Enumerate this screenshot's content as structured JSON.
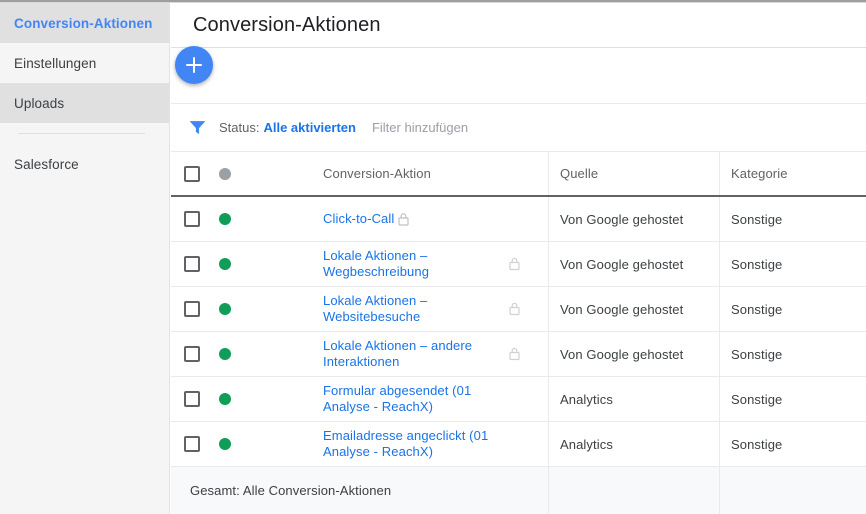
{
  "sidebar": {
    "items": [
      {
        "label": "Conversion-Aktionen",
        "state": "active"
      },
      {
        "label": "Einstellungen",
        "state": "normal"
      },
      {
        "label": "Uploads",
        "state": "shaded"
      }
    ],
    "secondary_items": [
      {
        "label": "Salesforce",
        "state": "normal"
      }
    ]
  },
  "header": {
    "title": "Conversion-Aktionen"
  },
  "toolbar": {
    "add_button_icon": "plus-icon",
    "add_button_label": "+"
  },
  "filter_bar": {
    "funnel_icon": "filter-funnel-icon",
    "status_label": "Status:",
    "status_value": "Alle aktivierten",
    "add_filter_label": "Filter hinzufügen"
  },
  "table": {
    "columns": {
      "select_all": "",
      "status": "",
      "name": "Conversion-Aktion",
      "source": "Quelle",
      "category": "Kategorie"
    },
    "header_status_dot": "gray",
    "rows": [
      {
        "name": "Click-to-Call",
        "status": "green",
        "lock": "inline",
        "source": "Von Google gehostet",
        "category": "Sonstige"
      },
      {
        "name": "Lokale Aktionen – Wegbeschreibung",
        "status": "green",
        "lock": "right",
        "source": "Von Google gehostet",
        "category": "Sonstige"
      },
      {
        "name": "Lokale Aktionen – Websitebesuche",
        "status": "green",
        "lock": "right",
        "source": "Von Google gehostet",
        "category": "Sonstige"
      },
      {
        "name": "Lokale Aktionen – andere Interaktionen",
        "status": "green",
        "lock": "right",
        "source": "Von Google gehostet",
        "category": "Sonstige"
      },
      {
        "name": "Formular abgesendet (01 Analyse - ReachX)",
        "status": "green",
        "lock": "none",
        "source": "Analytics",
        "category": "Sonstige"
      },
      {
        "name": "Emailadresse angeclickt (01 Analyse - ReachX)",
        "status": "green",
        "lock": "none",
        "source": "Analytics",
        "category": "Sonstige"
      }
    ],
    "total_row": {
      "label": "Gesamt: Alle Conversion-Aktionen",
      "source": "",
      "category": ""
    }
  },
  "colors": {
    "accent_blue": "#1a73e8",
    "fab_blue": "#4285f4",
    "status_green": "#0f9d58",
    "status_gray": "#9aa0a6",
    "sidebar_bg": "#f5f5f5",
    "sidebar_active_bg": "#e0e0e0",
    "total_row_bg": "#f8f9fa"
  }
}
